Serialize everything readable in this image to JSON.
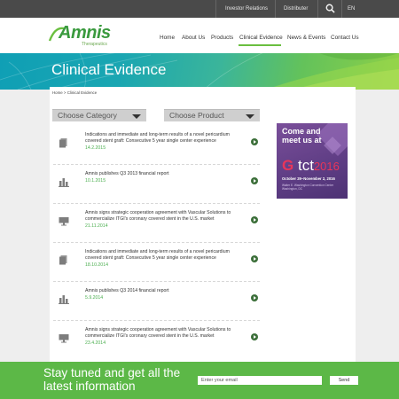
{
  "topbar": {
    "investor_relations": "Investor Relations",
    "distributer": "Distributer",
    "language": "EN",
    "search_icon": "search-icon"
  },
  "header": {
    "logo_text": "Amnis",
    "logo_subtext": "Therapeutics",
    "nav": [
      {
        "label": "Home"
      },
      {
        "label": "About Us"
      },
      {
        "label": "Products"
      },
      {
        "label": "Clinical Evidence",
        "active": true
      },
      {
        "label": "News & Events"
      },
      {
        "label": "Contact Us"
      }
    ]
  },
  "hero": {
    "title": "Clinical Evidence"
  },
  "breadcrumb": "Home > Clinical Evidence",
  "filters": {
    "category": "Choose Category",
    "product": "Choose Product"
  },
  "news": [
    {
      "icon": "document-icon",
      "text": "Indications and immediate and long-term results of a novel pericardium covered stent graft: Consecutive 5 year single center experience",
      "date": "14.2.2015"
    },
    {
      "icon": "bar-chart-icon",
      "text": "Amnis publishes Q3 2013 financial report",
      "date": "10.1.2015"
    },
    {
      "icon": "monitor-icon",
      "text": "Amnis signs strategic cooperation agreement with Vascular Solutions to commercialize ITGI's coronary covered stent in the U.S. market",
      "date": "21.11.2014"
    },
    {
      "icon": "document-icon",
      "text": "Indications and immediate and long-term results of a novel pericardium covered stent graft: Consecutive 5 year single center experience",
      "date": "18.10.2014"
    },
    {
      "icon": "bar-chart-icon",
      "text": "Amnis publishes Q3 2014 financial report",
      "date": "5.9.2014"
    },
    {
      "icon": "monitor-icon",
      "text": "Amnis signs strategic cooperation agreement with Vascular Solutions to commercialize ITGI's coronary covered stent in the U.S. market",
      "date": "23.4.2014"
    }
  ],
  "ad": {
    "heading": "Come and meet us at",
    "logo_t": "tct",
    "logo_year": "2016",
    "dates": "October 29–November 2, 2016",
    "venue": "Walter E. Washington Convention Center Washington, DC"
  },
  "footer": {
    "headline": "Stay tuned and get all the latest information",
    "email_placeholder": "Enter your email",
    "send_label": "Send"
  },
  "colors": {
    "topbar": "#4a4a4a",
    "accent_green": "#5cb847",
    "date_green": "#4caf50",
    "ad_purple": "#5e3d84"
  }
}
